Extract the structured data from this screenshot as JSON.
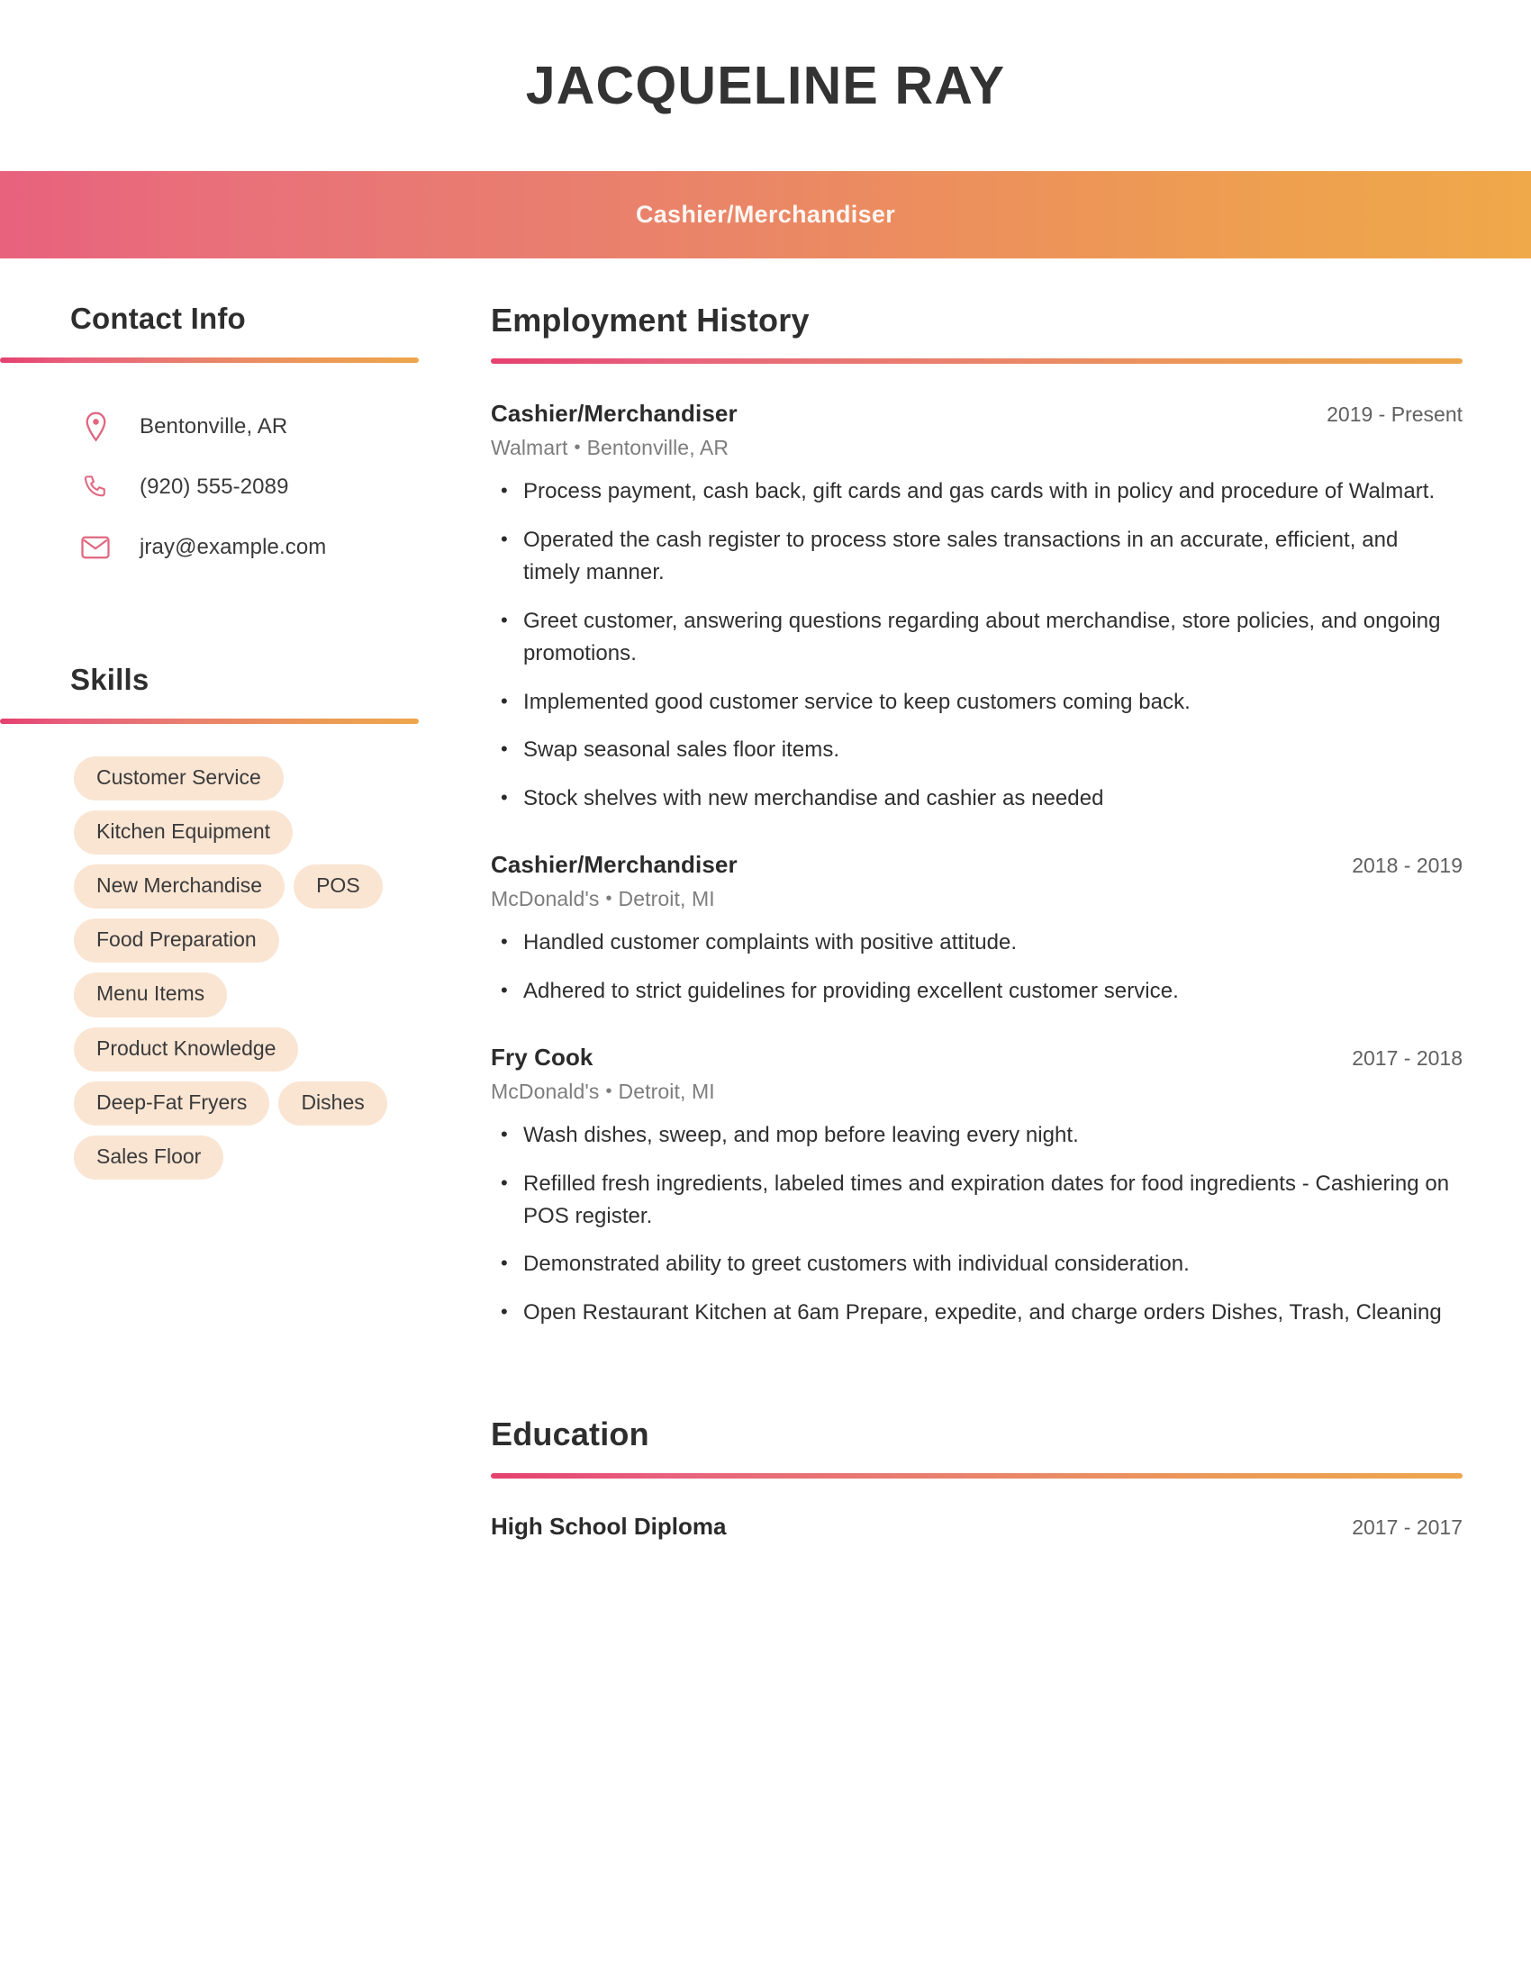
{
  "colors": {
    "gradient_start": "#e5416f",
    "gradient_end": "#eda64c",
    "icon": "#e0677f",
    "pill_bg": "#fae5d3",
    "heading_text": "#2e2e2e",
    "body_text": "#2f2f2f",
    "muted_text": "#7d7d7d",
    "date_text": "#606060",
    "title_bar_text": "#fdf6f2"
  },
  "header": {
    "name": "JACQUELINE RAY",
    "job_title": "Cashier/Merchandiser"
  },
  "sidebar": {
    "contact": {
      "heading": "Contact Info",
      "items": [
        {
          "icon": "location-pin-icon",
          "value": "Bentonville, AR"
        },
        {
          "icon": "phone-icon",
          "value": "(920) 555-2089"
        },
        {
          "icon": "email-icon",
          "value": "jray@example.com"
        }
      ]
    },
    "skills": {
      "heading": "Skills",
      "items": [
        "Customer Service",
        "Kitchen Equipment",
        "New Merchandise",
        "POS",
        "Food Preparation",
        "Menu Items",
        "Product Knowledge",
        "Deep-Fat Fryers",
        "Dishes",
        "Sales Floor"
      ]
    }
  },
  "main": {
    "employment": {
      "heading": "Employment History",
      "jobs": [
        {
          "title": "Cashier/Merchandiser",
          "dates": "2019 - Present",
          "company": "Walmart",
          "separator": "•",
          "location": "Bentonville, AR",
          "bullets": [
            "Process payment, cash back, gift cards and gas cards with in policy and procedure of Walmart.",
            "Operated the cash register to process store sales transactions in an accurate, efficient, and timely manner.",
            "Greet customer, answering questions regarding about merchandise, store policies, and ongoing promotions.",
            "Implemented good customer service to keep customers coming back.",
            "Swap seasonal sales floor items.",
            "Stock shelves with new merchandise and cashier as needed"
          ]
        },
        {
          "title": "Cashier/Merchandiser",
          "dates": "2018 - 2019",
          "company": "McDonald's",
          "separator": "•",
          "location": "Detroit, MI",
          "bullets": [
            "Handled customer complaints with positive attitude.",
            "Adhered to strict guidelines for providing excellent customer service."
          ]
        },
        {
          "title": "Fry Cook",
          "dates": "2017 - 2018",
          "company": "McDonald's",
          "separator": "•",
          "location": "Detroit, MI",
          "bullets": [
            "Wash dishes, sweep, and mop before leaving every night.",
            "Refilled fresh ingredients, labeled times and expiration dates for food ingredients - Cashiering on POS register.",
            "Demonstrated ability to greet customers with individual consideration.",
            "Open Restaurant Kitchen at 6am Prepare, expedite, and charge orders Dishes, Trash, Cleaning"
          ]
        }
      ]
    },
    "education": {
      "heading": "Education",
      "entries": [
        {
          "degree": "High School Diploma",
          "dates": "2017 - 2017"
        }
      ]
    }
  }
}
